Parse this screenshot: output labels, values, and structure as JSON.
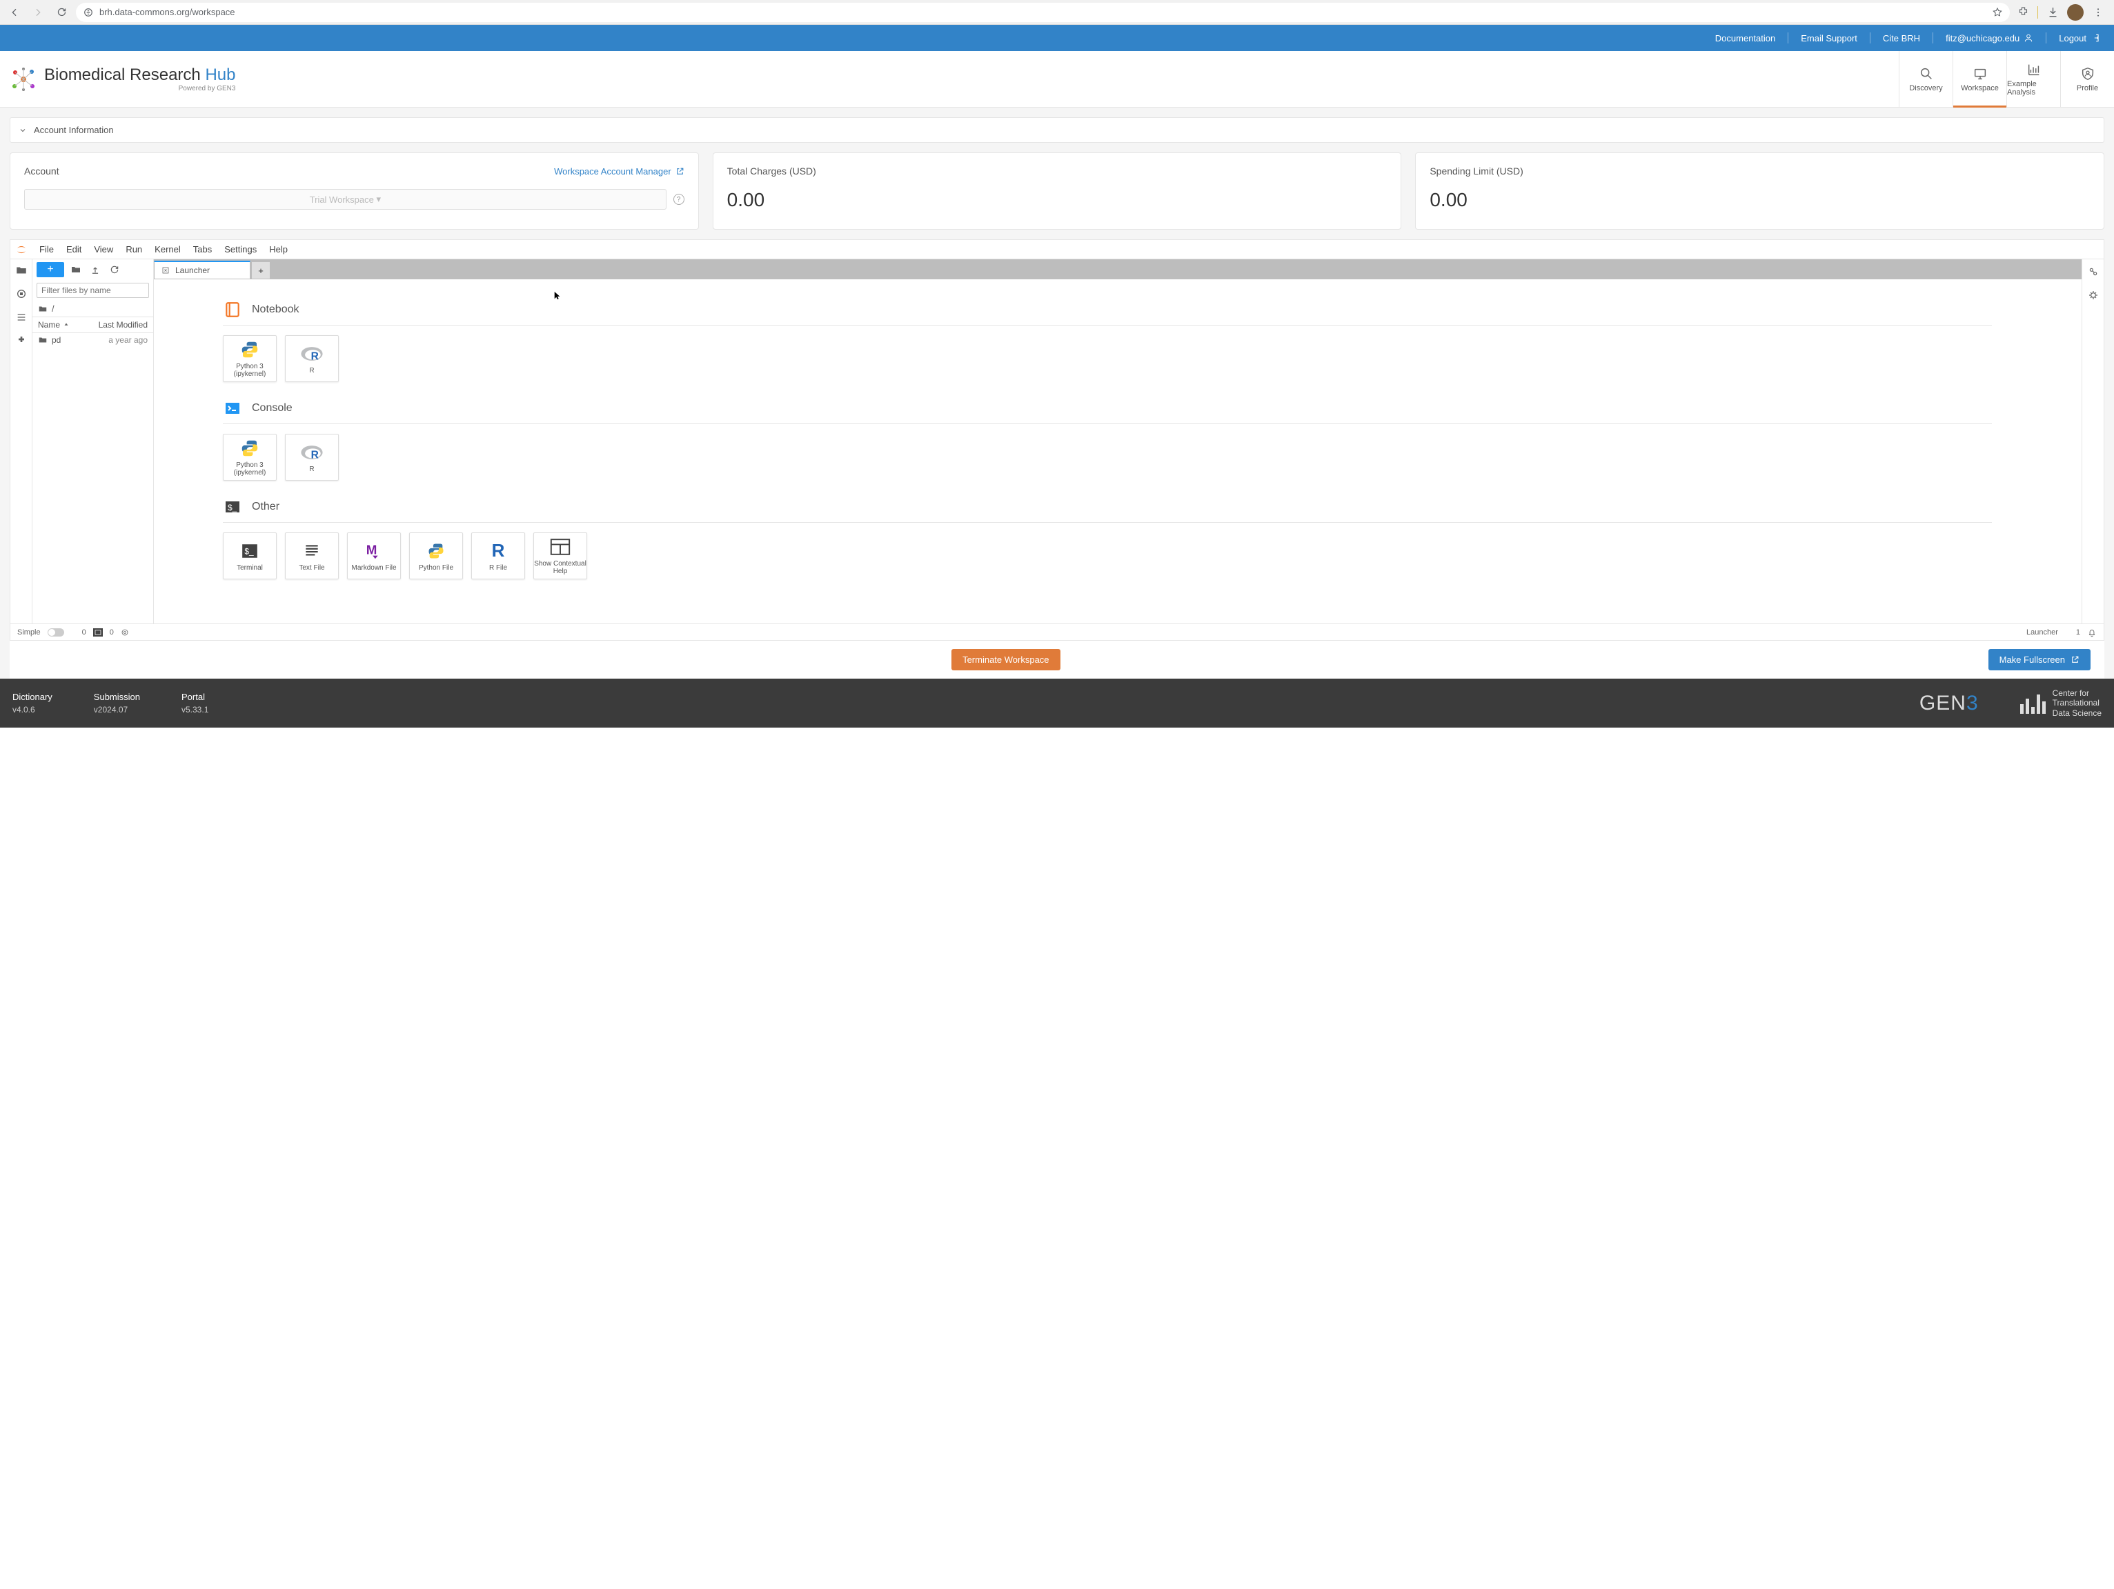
{
  "chrome": {
    "url": "brh.data-commons.org/workspace"
  },
  "topbar": {
    "documentation": "Documentation",
    "email_support": "Email Support",
    "cite": "Cite BRH",
    "user": "fitz@uchicago.edu",
    "logout": "Logout"
  },
  "brand": {
    "title_pre": "Biomedical Research ",
    "title_post": "Hub",
    "sub": "Powered by GEN3"
  },
  "nav": {
    "discovery": "Discovery",
    "workspace": "Workspace",
    "example": "Example Analysis",
    "profile": "Profile"
  },
  "account_info": {
    "header": "Account Information",
    "account_label": "Account",
    "wam_link": "Workspace Account Manager",
    "trial_box": "Trial Workspace",
    "total_charges_label": "Total Charges (USD)",
    "total_charges_value": "0.00",
    "spending_label": "Spending Limit (USD)",
    "spending_value": "0.00"
  },
  "menus": {
    "file": "File",
    "edit": "Edit",
    "view": "View",
    "run": "Run",
    "kernel": "Kernel",
    "tabs": "Tabs",
    "settings": "Settings",
    "help": "Help"
  },
  "file_panel": {
    "filter_placeholder": "Filter files by name",
    "crumb": "/",
    "col_name": "Name",
    "col_modified": "Last Modified",
    "rows": [
      {
        "name": "pd",
        "modified": "a year ago"
      }
    ]
  },
  "tabs": {
    "launcher": "Launcher"
  },
  "launcher": {
    "notebook": {
      "title": "Notebook",
      "python": "Python 3 (ipykernel)",
      "r": "R"
    },
    "console": {
      "title": "Console",
      "python": "Python 3 (ipykernel)",
      "r": "R"
    },
    "other": {
      "title": "Other",
      "terminal": "Terminal",
      "text": "Text File",
      "markdown": "Markdown File",
      "python": "Python File",
      "rfile": "R File",
      "ctxhelp": "Show Contextual Help"
    }
  },
  "status": {
    "simple": "Simple",
    "zero1": "0",
    "zero2": "0",
    "launcher": "Launcher",
    "one": "1"
  },
  "actions": {
    "terminate": "Terminate Workspace",
    "fullscreen": "Make Fullscreen"
  },
  "footer": {
    "dict": "Dictionary",
    "dict_v": "v4.0.6",
    "sub": "Submission",
    "sub_v": "v2024.07",
    "portal": "Portal",
    "portal_v": "v5.33.1",
    "gen3": "GEN",
    "ctds1": "Center for",
    "ctds2": "Translational",
    "ctds3": "Data Science"
  }
}
